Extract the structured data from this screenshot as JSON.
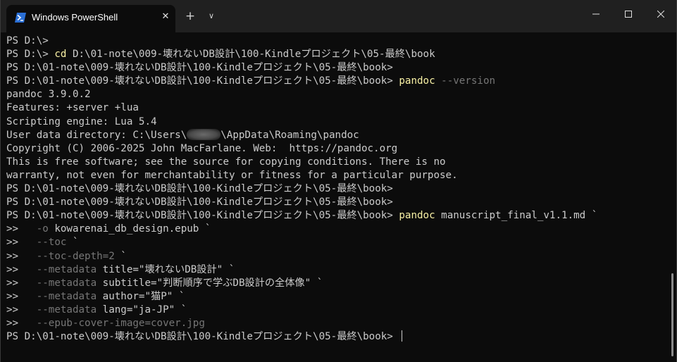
{
  "window": {
    "tab_title": "Windows PowerShell",
    "tab_icon": "powershell-icon",
    "close_tab_glyph": "✕",
    "new_tab_glyph": "+",
    "dropdown_glyph": "∨"
  },
  "colors": {
    "background": "#0c0c0c",
    "titlebar": "#202020",
    "text": "#cccccc",
    "command": "#f9f1a5",
    "parameter": "#767676"
  },
  "terminal": {
    "prompt_root": "PS D:\\>",
    "prompt_book": "PS D:\\01-note\\009-壊れないDB設計\\100-Kindleプロジェクト\\05-最終\\book>",
    "line2_cmd": "cd",
    "line2_arg": " D:\\01-note\\009-壊れないDB設計\\100-Kindleプロジェクト\\05-最終\\book",
    "line4_cmd": "pandoc",
    "line4_param": " --version",
    "version": "pandoc 3.9.0.2",
    "features": "Features: +server +lua",
    "scripting": "Scripting engine: Lua 5.4",
    "userdata_prefix": "User data directory: C:\\Users\\",
    "userdata_suffix": "\\AppData\\Roaming\\pandoc",
    "copyright": "Copyright (C) 2006-2025 John MacFarlane. Web:  https://pandoc.org",
    "free_sw": "This is free software; see the source for copying conditions. There is no",
    "warranty": "warranty, not even for merchantability or fitness for a particular purpose.",
    "cont": ">>",
    "cmd3_cmd": "pandoc",
    "cmd3_arg": " manuscript_final_v1.1.md `",
    "opt_o_param": "-o",
    "opt_o_arg": " kowarenai_db_design.epub `",
    "opt_toc_param": "--toc",
    "opt_toc_arg": " `",
    "opt_depth_param": "--toc-depth=2",
    "opt_depth_arg": " `",
    "meta_param": "--metadata",
    "meta_title": " title=\"壊れないDB設計\" `",
    "meta_subtitle": " subtitle=\"判断順序で学ぶDB設計の全体像\" `",
    "meta_author": " author=\"猫P\" `",
    "meta_lang": " lang=\"ja-JP\" `",
    "opt_cover_param": "--epub-cover-image=cover.jpg"
  }
}
